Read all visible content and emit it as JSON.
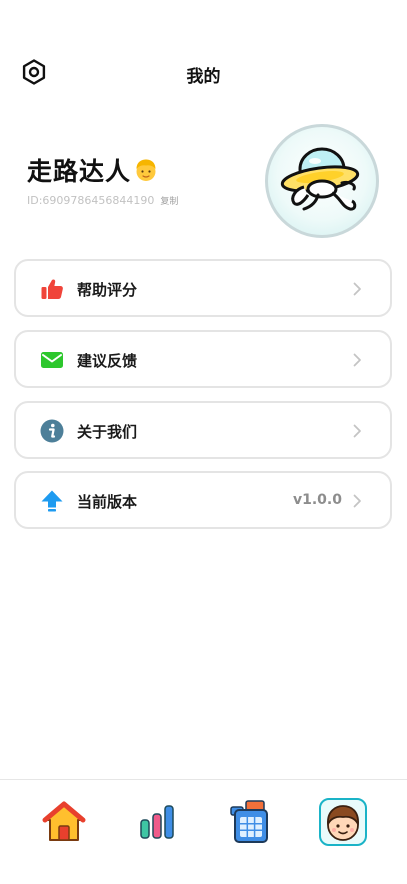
{
  "header": {
    "title": "我的",
    "settings_icon": "gear-icon"
  },
  "profile": {
    "username": "走路达人",
    "emoji_icon": "person-blond-emoji-icon",
    "id_text": "ID:6909786456844190",
    "copy_label": "复制",
    "avatar_icon": "ufo-runner-avatar-icon"
  },
  "menu": [
    {
      "label": "帮助评分",
      "icon": "thumbs-up-icon",
      "color": "#f0443a"
    },
    {
      "label": "建议反馈",
      "icon": "mail-icon",
      "color": "#2dc72d"
    },
    {
      "label": "关于我们",
      "icon": "info-icon",
      "color": "#4d7f99"
    },
    {
      "label": "当前版本",
      "icon": "upload-arrow-icon",
      "color": "#1e9bf0",
      "value": "v1.0.0"
    }
  ],
  "tabbar": {
    "tabs": [
      {
        "name": "home",
        "icon": "home-icon"
      },
      {
        "name": "stats",
        "icon": "bar-chart-icon"
      },
      {
        "name": "calendar",
        "icon": "calendar-icon"
      },
      {
        "name": "profile",
        "icon": "avatar-icon",
        "active": true
      }
    ]
  },
  "colors": {
    "border": "#e4e4e4",
    "text": "#111111",
    "muted": "#c2c2c2"
  }
}
